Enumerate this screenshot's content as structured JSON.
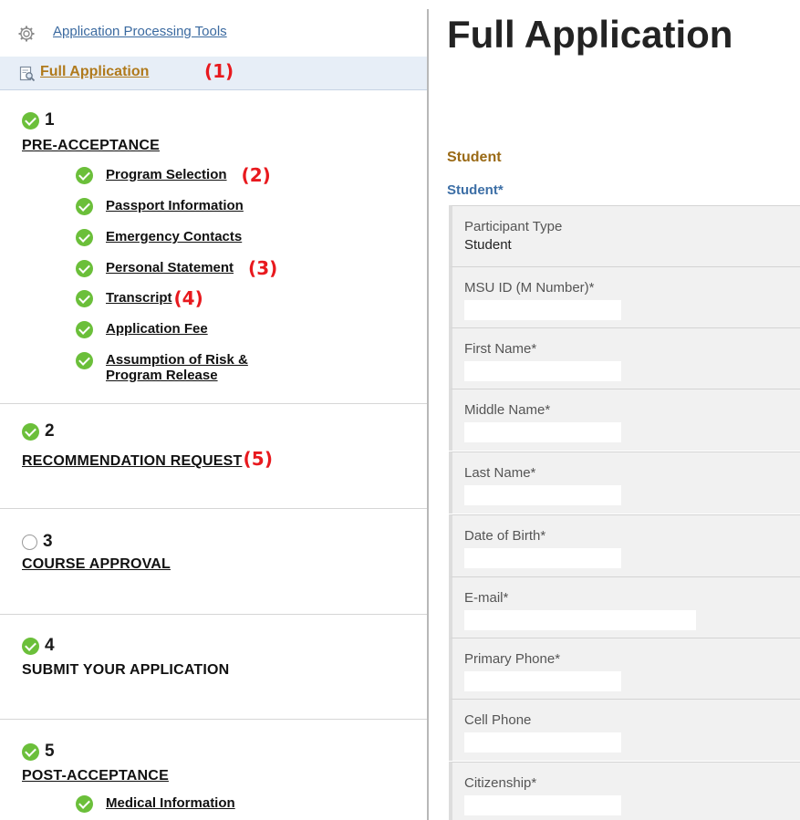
{
  "sidebar": {
    "tools_link": "Application Processing Tools",
    "full_app_link": "Full Application",
    "full_app_anno": "(1)",
    "sections": [
      {
        "num": "1",
        "title": "PRE-ACCEPTANCE",
        "status": "complete",
        "steps": [
          {
            "label": "Program Selection",
            "anno": "(2)"
          },
          {
            "label": "Passport Information",
            "anno": ""
          },
          {
            "label": "Emergency Contacts",
            "anno": ""
          },
          {
            "label": "Personal Statement",
            "anno": "(3)"
          },
          {
            "label": "Transcript",
            "anno": "(4)"
          },
          {
            "label": "Application Fee",
            "anno": ""
          },
          {
            "label_line1": "Assumption of Risk &",
            "label_line2": "Program Release",
            "anno": ""
          }
        ]
      },
      {
        "num": "2",
        "title": "RECOMMENDATION REQUEST",
        "anno": "(5)",
        "status": "complete"
      },
      {
        "num": "3",
        "title": "COURSE APPROVAL",
        "status": "incomplete"
      },
      {
        "num": "4",
        "title": "SUBMIT YOUR APPLICATION",
        "status": "complete"
      },
      {
        "num": "5",
        "title": "POST-ACCEPTANCE",
        "status": "complete",
        "steps": [
          {
            "label": "Medical Information",
            "anno": ""
          }
        ]
      }
    ]
  },
  "main": {
    "title": "Full Application",
    "section_heading": "Student",
    "subsection_heading": "Student*",
    "fields": [
      {
        "label": "Participant Type",
        "value": "Student"
      },
      {
        "label": "MSU ID (M Number)*",
        "value": ""
      },
      {
        "label": "First Name*",
        "value": ""
      },
      {
        "label": "Middle Name*",
        "value": ""
      },
      {
        "label": "Last Name*",
        "value": ""
      },
      {
        "label": "Date of Birth*",
        "value": ""
      },
      {
        "label": "E-mail*",
        "value": ""
      },
      {
        "label": "Primary Phone*",
        "value": ""
      },
      {
        "label": "Cell Phone",
        "value": ""
      },
      {
        "label": "Citizenship*",
        "value": ""
      }
    ]
  },
  "colors": {
    "link_blue": "#3b6aa0",
    "active_gold": "#b07a1c",
    "check_green": "#6bbf3a",
    "annotation_red": "#e8191e",
    "section_gold": "#9a6a16",
    "subsection_blue": "#3d6fa6"
  },
  "icons": {
    "tools": "gear-icon",
    "full_application": "document-search-icon",
    "complete": "check-circle-icon",
    "incomplete": "empty-circle-icon"
  }
}
